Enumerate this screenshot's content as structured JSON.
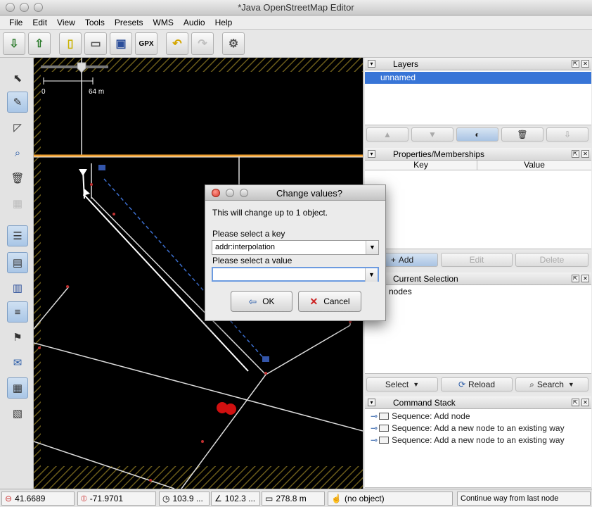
{
  "window": {
    "title": "*Java OpenStreetMap Editor"
  },
  "menu": [
    "File",
    "Edit",
    "View",
    "Tools",
    "Presets",
    "WMS",
    "Audio",
    "Help"
  ],
  "toolbar": {
    "gpx_label": "GPX"
  },
  "scale": {
    "start": "0",
    "end": "64 m"
  },
  "layers": {
    "title": "Layers",
    "items": [
      "unnamed"
    ]
  },
  "properties": {
    "title": "Properties/Memberships",
    "columns": [
      "Key",
      "Value"
    ],
    "buttons": {
      "add": "Add",
      "edit": "Edit",
      "delete": "Delete"
    }
  },
  "selection": {
    "title": "Current Selection",
    "text": "nodes",
    "buttons": {
      "select": "Select",
      "reload": "Reload",
      "search": "Search"
    }
  },
  "command_stack": {
    "title": "Command Stack",
    "items": [
      "Sequence: Add node",
      "Sequence: Add a new node to an existing way",
      "Sequence: Add a new node to an existing way"
    ]
  },
  "status": {
    "lat": "41.6689",
    "lon": "-71.9701",
    "heading": "103.9 ...",
    "angle": "102.3 ...",
    "distance": "278.8 m",
    "object": "(no object)",
    "help": "Continue way from last node"
  },
  "dialog": {
    "title": "Change values?",
    "message": "This will change up to 1 object.",
    "key_label": "Please select a key",
    "key_value": "addr:interpolation",
    "value_label": "Please select a value",
    "value_value": "",
    "ok": "OK",
    "cancel": "Cancel"
  },
  "colors": {
    "map_bg": "#000000",
    "highlight_road": "#f0a030",
    "stop_sign": "#d01010"
  }
}
